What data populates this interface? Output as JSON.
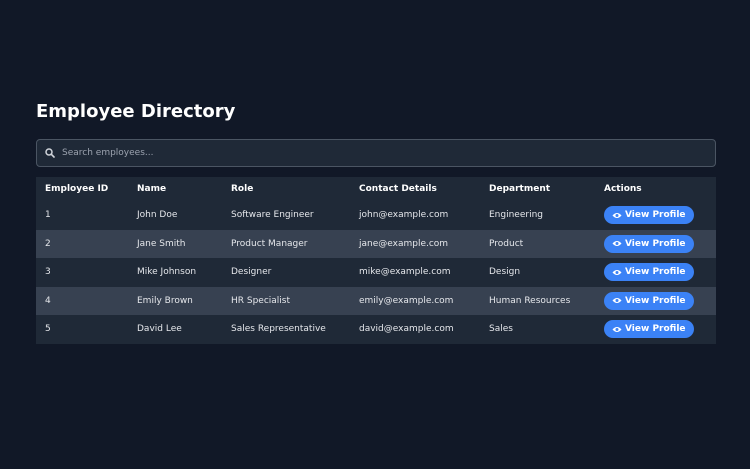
{
  "page": {
    "title": "Employee Directory"
  },
  "search": {
    "placeholder": "Search employees...",
    "icon": "search-icon"
  },
  "table": {
    "headers": [
      "Employee ID",
      "Name",
      "Role",
      "Contact Details",
      "Department",
      "Actions"
    ],
    "rows": [
      {
        "id": "1",
        "name": "John Doe",
        "role": "Software Engineer",
        "contact": "john@example.com",
        "department": "Engineering",
        "action": "View Profile"
      },
      {
        "id": "2",
        "name": "Jane Smith",
        "role": "Product Manager",
        "contact": "jane@example.com",
        "department": "Product",
        "action": "View Profile"
      },
      {
        "id": "3",
        "name": "Mike Johnson",
        "role": "Designer",
        "contact": "mike@example.com",
        "department": "Design",
        "action": "View Profile"
      },
      {
        "id": "4",
        "name": "Emily Brown",
        "role": "HR Specialist",
        "contact": "emily@example.com",
        "department": "Human Resources",
        "action": "View Profile"
      },
      {
        "id": "5",
        "name": "David Lee",
        "role": "Sales Representative",
        "contact": "david@example.com",
        "department": "Sales",
        "action": "View Profile"
      }
    ]
  },
  "colors": {
    "background": "#111827",
    "row_dark": "#1f2937",
    "row_light": "#374151",
    "accent": "#3b82f6"
  }
}
